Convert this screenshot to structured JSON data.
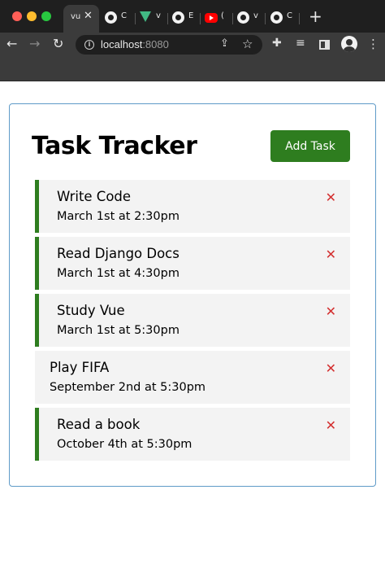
{
  "browser": {
    "tabs": [
      {
        "title": "vu",
        "active": true,
        "icon": "vue-icon"
      },
      {
        "title": "C",
        "icon": "github-icon"
      },
      {
        "title": "v",
        "icon": "vue-icon"
      },
      {
        "title": "E",
        "icon": "github-icon"
      },
      {
        "title": "(",
        "icon": "youtube-icon"
      },
      {
        "title": "v",
        "icon": "github-icon"
      },
      {
        "title": "C",
        "icon": "github-icon"
      }
    ],
    "new_tab": "+",
    "url_host": "localhost",
    "url_port": ":8080"
  },
  "app": {
    "title": "Task Tracker",
    "add_button": "Add Task",
    "accent_color": "#2e7d1f",
    "delete_color": "#d32f2f",
    "tasks": [
      {
        "text": "Write Code",
        "day": "March 1st at 2:30pm",
        "reminder": true
      },
      {
        "text": "Read Django Docs",
        "day": "March 1st at 4:30pm",
        "reminder": true
      },
      {
        "text": "Study Vue",
        "day": "March 1st at 5:30pm",
        "reminder": true
      },
      {
        "text": "Play FIFA",
        "day": "September 2nd at 5:30pm",
        "reminder": false
      },
      {
        "text": "Read a book",
        "day": "October 4th at 5:30pm",
        "reminder": true
      }
    ]
  }
}
